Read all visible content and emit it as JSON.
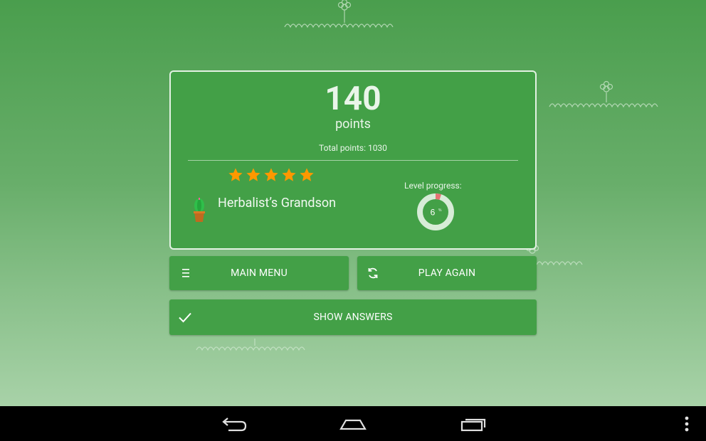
{
  "result": {
    "score": "140",
    "points_label": "points",
    "total_points": "Total points: 1030",
    "stars": 5,
    "rank_title": "Herbalist’s Grandson",
    "level_label": "Level progress:",
    "level_number": "6",
    "level_progress_fraction": 0.05
  },
  "buttons": {
    "main_menu": "MAIN MENU",
    "play_again": "PLAY AGAIN",
    "show_answers": "SHOW ANSWERS"
  },
  "icons": {
    "menu": "menu-icon",
    "refresh": "refresh-icon",
    "check": "check-icon",
    "star": "star-icon",
    "plant": "cactus-pot-icon",
    "back": "back-icon",
    "home": "home-icon",
    "recents": "recent-apps-icon",
    "overflow": "overflow-menu-icon"
  },
  "colors": {
    "card_bg": "#43a047",
    "star": "#ff9800",
    "progress_accent": "#e57373",
    "ring_track": "#d7ecd7",
    "navbar": "#000000"
  }
}
